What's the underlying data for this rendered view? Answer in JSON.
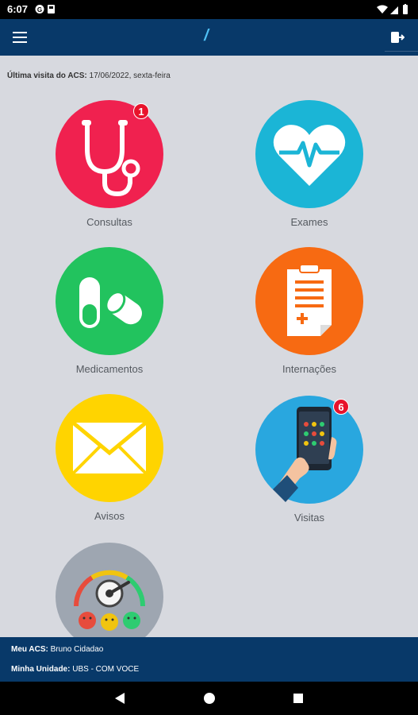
{
  "status_bar": {
    "time": "6:07"
  },
  "app_bar": {
    "title": "/"
  },
  "last_visit": {
    "label": "Última visita do ACS:",
    "value": "17/06/2022, sexta-feira"
  },
  "tiles": [
    {
      "label": "Consultas",
      "icon": "stethoscope-icon",
      "color": "#f0214f",
      "badge": "1"
    },
    {
      "label": "Exames",
      "icon": "heart-pulse-icon",
      "color": "#1bb5d6",
      "badge": ""
    },
    {
      "label": "Medicamentos",
      "icon": "pills-icon",
      "color": "#22c35e",
      "badge": ""
    },
    {
      "label": "Internações",
      "icon": "clipboard-medical-icon",
      "color": "#f76a12",
      "badge": ""
    },
    {
      "label": "Avisos",
      "icon": "envelope-icon",
      "color": "#ffd400",
      "badge": ""
    },
    {
      "label": "Visitas",
      "icon": "phone-in-hand-icon",
      "color": "#29a7df",
      "badge": "6"
    },
    {
      "label": "",
      "icon": "satisfaction-gauge-icon",
      "color": "#9ea6b1",
      "badge": ""
    }
  ],
  "footer": {
    "acs_label": "Meu ACS:",
    "acs_value": "Bruno Cidadao",
    "unit_label": "Minha Unidade:",
    "unit_value": "UBS - COM VOCE"
  }
}
